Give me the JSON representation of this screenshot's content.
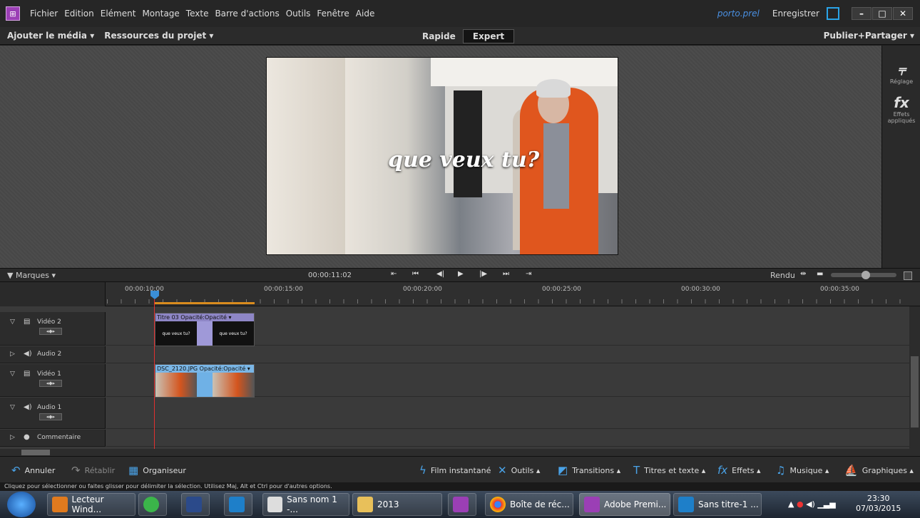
{
  "menu": {
    "items": [
      "Fichier",
      "Edition",
      "Elément",
      "Montage",
      "Texte",
      "Barre d'actions",
      "Outils",
      "Fenêtre",
      "Aide"
    ],
    "project_file": "porto.prel",
    "save_label": "Enregistrer"
  },
  "modebar": {
    "add_media": "Ajouter le média ▾",
    "project_assets": "Ressources du projet ▾",
    "mode_quick": "Rapide",
    "mode_expert": "Expert",
    "publish": "Publier+Partager ▾"
  },
  "monitor": {
    "caption": "que veux tu?"
  },
  "right_panel": {
    "adjust": "Réglage",
    "effects": "Effets appliqués"
  },
  "timeline_bar": {
    "markers": "▼ Marques  ▾",
    "timecode": "00:00:11:02",
    "render": "Rendu"
  },
  "ruler": {
    "labels": [
      "00:00:10:00",
      "00:00:15:00",
      "00:00:20:00",
      "00:00:25:00",
      "00:00:30:00",
      "00:00:35:00"
    ]
  },
  "tracks": [
    {
      "name": "Vidéo 2",
      "kind": "video",
      "clip": "Titre 03  Opacité:Opacité ▾",
      "frame_text": "que veux tu?"
    },
    {
      "name": "Audio 2",
      "kind": "audio"
    },
    {
      "name": "Vidéo 1",
      "kind": "video",
      "clip": "DSC_2120.JPG  Opacité:Opacité ▾"
    },
    {
      "name": "Audio 1",
      "kind": "audio"
    },
    {
      "name": "Commentaire",
      "kind": "narration"
    }
  ],
  "action_bar": {
    "undo": "Annuler",
    "redo": "Rétablir",
    "organizer": "Organiseur",
    "instant_movie": "Film instantané",
    "tools": "Outils ▴",
    "transitions": "Transitions ▴",
    "titles": "Titres et texte ▴",
    "effects": "Effets ▴",
    "music": "Musique ▴",
    "graphics": "Graphiques ▴"
  },
  "status_text": "Cliquez pour sélectionner ou faites glisser pour délimiter la sélection. Utilisez Maj, Alt et Ctrl pour d'autres options.",
  "taskbar": {
    "buttons": [
      "Lecteur Wind...",
      "Sans nom 1 -...",
      "2013",
      "Boîte de réc...",
      "Adobe Premi...",
      "Sans titre-1 ..."
    ],
    "time": "23:30",
    "date": "07/03/2015"
  }
}
